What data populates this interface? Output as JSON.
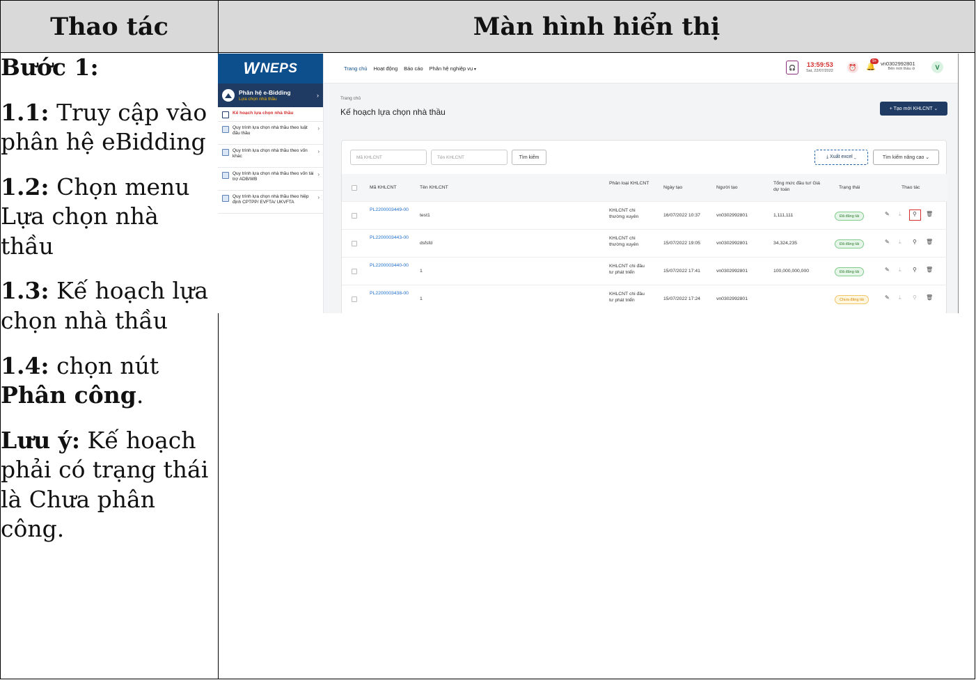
{
  "doc": {
    "col_left_header": "Thao tác",
    "col_right_header": "Màn hình hiển thị",
    "step_title": "Bước 1:",
    "steps": [
      {
        "num": "1.1:",
        "text": " Truy cập vào phân hệ eBidding"
      },
      {
        "num": "1.2:",
        "text": " Chọn menu Lựa chọn nhà thầu"
      },
      {
        "num": "1.3:",
        "text": " Kế hoạch lựa chọn nhà thầu"
      },
      {
        "num": "1.4:",
        "text": " chọn nút ",
        "bold": "Phân công",
        "after": "."
      }
    ],
    "note_label": "Lưu ý:",
    "note_text": " Kế hoạch phải có trạng thái là Chưa phân công."
  },
  "app": {
    "logo": "NEPS",
    "module_title": "Phân hệ e-Bidding",
    "module_sub": "Lựa chọn nhà thầu",
    "sidebar_items": [
      {
        "label": "Kế hoạch lựa chọn nhà thầu",
        "active": true
      },
      {
        "label": "Quy trình lựa chọn nhà thầu theo luật đấu thầu"
      },
      {
        "label": "Quy trình lựa chọn nhà thầu theo vốn khác"
      },
      {
        "label": "Quy trình lựa chọn nhà thầu theo vốn tài trợ ADB/WB"
      },
      {
        "label": "Quy trình lựa chọn nhà thầu theo hiệp định CPTPP/ EVFTA/ UKVFTA"
      }
    ],
    "nav": [
      "Trang chủ",
      "Hoạt động",
      "Báo cáo",
      "Phân hệ nghiệp vụ"
    ],
    "time": "13:59:53",
    "date": "Sat, 22/07/2022",
    "notif_badge": "9+",
    "username": "vn0302992801",
    "role": "Bên mời thầu ⊘",
    "avatar_letter": "V",
    "breadcrumb": "Trang chủ",
    "page_title": "Kế hoạch lựa chọn nhà thầu",
    "new_button": "+ Tạo mới KHLCNT ⌄",
    "search_code_placeholder": "Mã KHLCNT",
    "search_name_placeholder": "Tên KHLCNT",
    "search_button": "Tìm kiếm",
    "export_button": "⤓ Xuất excel ⌄",
    "advanced_button": "Tìm kiếm nâng cao ⌄",
    "columns": {
      "code": "Mã KHLCNT",
      "name": "Tên KHLCNT",
      "type": "Phân loại KHLCNT",
      "date": "Ngày tạo",
      "creator": "Người tạo",
      "total": "Tổng mức đầu tư/ Giá dự toán",
      "status": "Trạng thái",
      "actions": "Thao tác"
    },
    "rows": [
      {
        "code": "PL2200003449-00",
        "name": "test1",
        "type": "KHLCNT chi thường xuyên",
        "date": "16/07/2022 10:37",
        "creator": "vn0302992801",
        "total": "1,111,111",
        "status": "Đã đăng tải",
        "status_kind": "ok"
      },
      {
        "code": "PL2200003443-00",
        "name": "dsfsfd",
        "type": "KHLCNT chi thường xuyên",
        "date": "15/07/2022 19:05",
        "creator": "vn0302992801",
        "total": "34,324,235",
        "status": "Đã đăng tải",
        "status_kind": "ok"
      },
      {
        "code": "PL2200003440-00",
        "name": "1",
        "type": "KHLCNT chi đầu tư phát triển",
        "date": "15/07/2022 17:41",
        "creator": "vn0302992801",
        "total": "100,000,000,000",
        "status": "Đã đăng tải",
        "status_kind": "ok"
      },
      {
        "code": "PL2200003438-00",
        "name": "1",
        "type": "KHLCNT chi đầu tư phát triển",
        "date": "15/07/2022 17:24",
        "creator": "vn0302992801",
        "total": "",
        "status": "Chưa đăng tải",
        "status_kind": "no"
      }
    ]
  }
}
